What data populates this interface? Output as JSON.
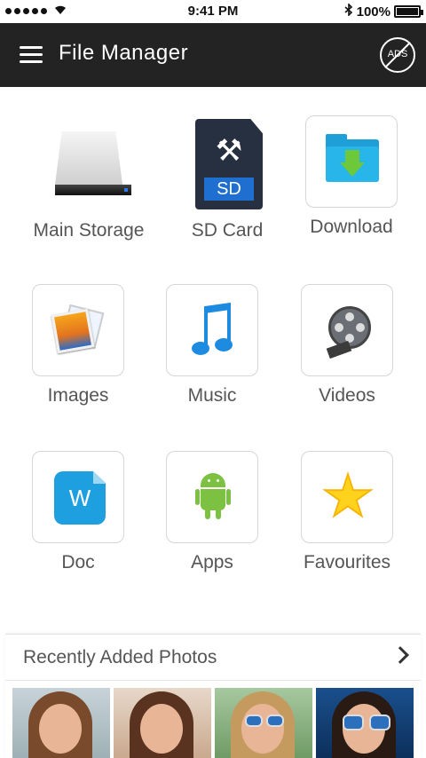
{
  "status_bar": {
    "time": "9:41 PM",
    "battery": "100%",
    "bluetooth_icon": "bluetooth-icon",
    "wifi_icon": "wifi-icon"
  },
  "app_bar": {
    "title": "File Manager",
    "ads_label": "ADS"
  },
  "categories": [
    {
      "label": "Main Storage",
      "icon": "hard-drive-icon"
    },
    {
      "label": "SD Card",
      "icon": "sd-card-icon",
      "badge": "SD"
    },
    {
      "label": "Download",
      "icon": "download-folder-icon"
    },
    {
      "label": "Images",
      "icon": "images-icon"
    },
    {
      "label": "Music",
      "icon": "music-note-icon"
    },
    {
      "label": "Videos",
      "icon": "film-reel-icon"
    },
    {
      "label": "Doc",
      "icon": "document-icon",
      "badge": "W"
    },
    {
      "label": "Apps",
      "icon": "android-icon"
    },
    {
      "label": "Favourites",
      "icon": "star-icon"
    }
  ],
  "recent": {
    "title": "Recently Added Photos",
    "photos": [
      "photo-1",
      "photo-2",
      "photo-3",
      "photo-4"
    ]
  },
  "colors": {
    "app_bar": "#232323",
    "label_text": "#555555",
    "tile_border": "#d6d6d6"
  }
}
